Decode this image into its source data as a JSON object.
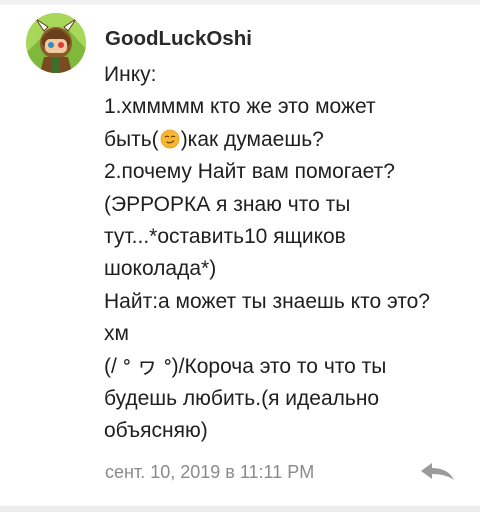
{
  "comment": {
    "username": "GoodLuckOshi",
    "avatar_icon": "anime-character-avatar",
    "lines": [
      {
        "text": "Инку:"
      },
      {
        "text": "1.хммммм кто же это может"
      },
      {
        "before": "быть(",
        "emoji": "smirk-emoji",
        "after": ")как думаешь?"
      },
      {
        "text": "2.почему Найт вам помогает?"
      },
      {
        "text": "(ЭРРОРКА я знаю что ты"
      },
      {
        "text": "тут...*оставить10 ящиков"
      },
      {
        "text": "шоколада*)"
      },
      {
        "text": "Найт:а может ты знаешь кто это?"
      },
      {
        "text": "хм"
      },
      {
        "text": "(/ ᐤ ヮ ᐤ)/Короча это то что ты"
      },
      {
        "text": "будешь любить.(я идеально"
      },
      {
        "text": "объясняю)"
      }
    ],
    "timestamp": "сент. 10, 2019 в 11:11 PM",
    "reply_icon": "reply-arrow-icon"
  },
  "colors": {
    "username": "#2a2a2a",
    "text": "#1f1f1f",
    "timestamp": "#8a8a8a",
    "reply_icon": "#9b9b9b",
    "emoji_face": "#f7b733"
  }
}
